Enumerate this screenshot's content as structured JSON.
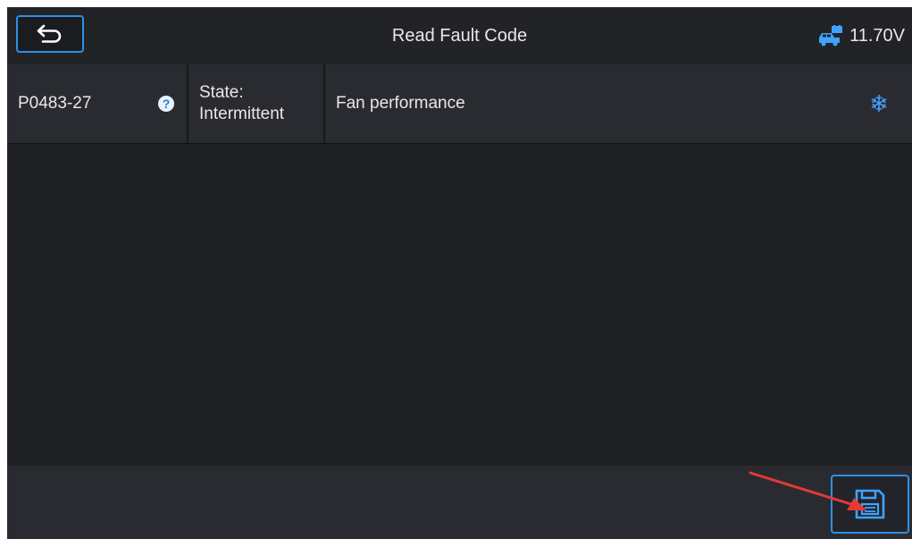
{
  "header": {
    "title": "Read Fault Code",
    "battery_voltage": "11.70V",
    "back_icon": "back-arrow-icon",
    "battery_icon": "vehicle-battery-icon"
  },
  "fault": {
    "code": "P0483-27",
    "state_label": "State:",
    "state_value": "Intermittent",
    "description": "Fan performance",
    "help_icon": "help-icon",
    "freeze_frame_icon": "snowflake-icon"
  },
  "footer": {
    "save_icon": "save-icon"
  },
  "colors": {
    "accent": "#2f8fe6",
    "background": "#1f2024",
    "row_background": "#2a2b30",
    "annotation_arrow": "#e53935"
  }
}
